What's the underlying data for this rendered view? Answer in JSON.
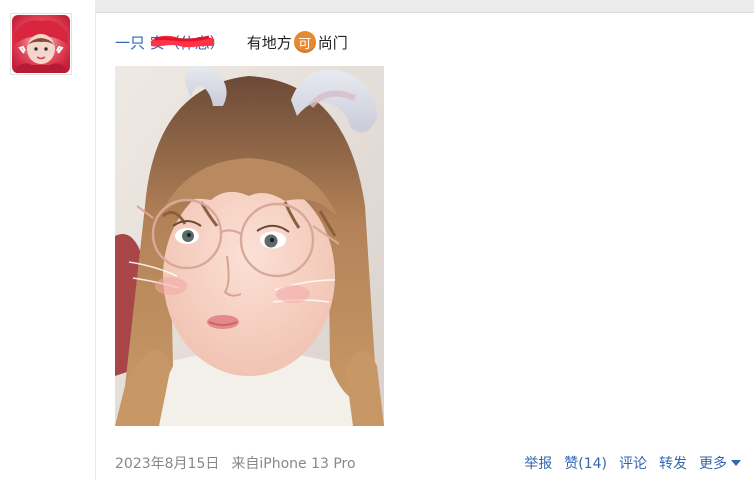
{
  "post": {
    "author": "一只 安（休息）",
    "text_before": "有地方",
    "emoji_char": "可",
    "text_after": "尚门",
    "date": "2023年8月15日",
    "source": "来自iPhone 13 Pro"
  },
  "actions": {
    "report": "举报",
    "like": "赞(14)",
    "comment": "评论",
    "repost": "转发",
    "more": "更多"
  },
  "icons": {
    "avatar": "avatar-icon",
    "emoji": "emoji-icon",
    "more_caret": "caret-down-icon"
  },
  "colors": {
    "link": "#3366b0",
    "meta": "#888888",
    "emoji_badge": "#e9892f",
    "redaction": "#ff3344"
  }
}
